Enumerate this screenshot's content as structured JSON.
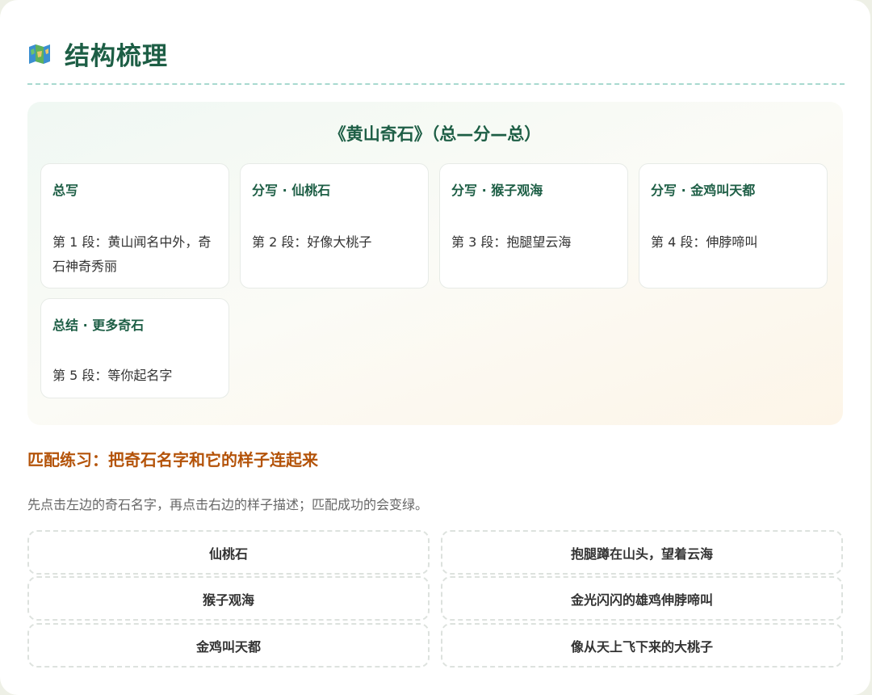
{
  "header": {
    "icon": "map-icon",
    "title": "结构梳理"
  },
  "structure": {
    "title": "《黄山奇石》（总—分—总）",
    "sections": [
      {
        "label": "总写",
        "text": "第 1 段：黄山闻名中外，奇石神奇秀丽"
      },
      {
        "label": "分写 · 仙桃石",
        "text": "第 2 段：好像大桃子"
      },
      {
        "label": "分写 · 猴子观海",
        "text": "第 3 段：抱腿望云海"
      },
      {
        "label": "分写 · 金鸡叫天都",
        "text": "第 4 段：伸脖啼叫"
      },
      {
        "label": "总结 · 更多奇石",
        "text": "第 5 段：等你起名字"
      }
    ]
  },
  "exercise": {
    "title": "匹配练习：把奇石名字和它的样子连起来",
    "instruction": "先点击左边的奇石名字，再点击右边的样子描述；匹配成功的会变绿。",
    "names": [
      "仙桃石",
      "猴子观海",
      "金鸡叫天都"
    ],
    "descriptions": [
      "抱腿蹲在山头，望着云海",
      "金光闪闪的雄鸡伸脖啼叫",
      "像从天上飞下来的大桃子"
    ]
  },
  "colors": {
    "title_green": "#1d5e45",
    "exercise_orange": "#b45309",
    "divider": "#a8d9cf"
  }
}
